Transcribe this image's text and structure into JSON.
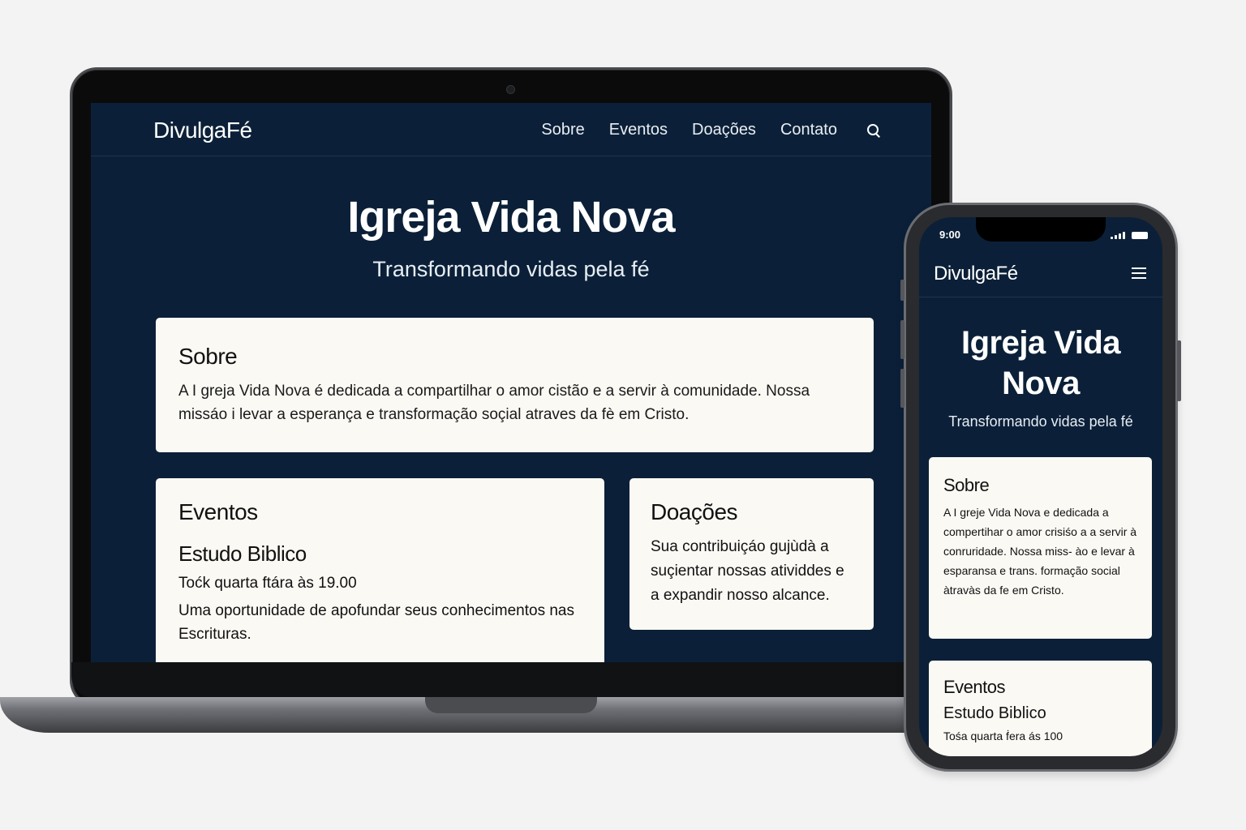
{
  "laptop": {
    "nav": {
      "logo": "DivulgaFé",
      "items": [
        {
          "label": "Sobre"
        },
        {
          "label": "Eventos"
        },
        {
          "label": "Doações"
        },
        {
          "label": "Contato"
        }
      ],
      "search_icon": "search-icon"
    },
    "hero": {
      "title": "Igreja Vida Nova",
      "subtitle": "Transformando vidas pela fé"
    },
    "sobre": {
      "heading": "Sobre",
      "text": "A I greja Vida Nova é dedicada a compartilhar o amor cistão e a servir à comunidade. Nossa missáo i levar a esperança e transformação soçial atraves da fè em Cristo."
    },
    "eventos": {
      "heading": "Eventos",
      "event_title": "Estudo Biblico",
      "when": "Toćk quarta ftára às 19.00",
      "description": "Uma oportunidade de apofundar seus conhecimentos nas Escrituras."
    },
    "doacoes": {
      "heading": "Doações",
      "text": "Sua contribuiçáo gujùdà a suçientar nossas atividdes e a expandir nosso alcance."
    }
  },
  "phone": {
    "status": {
      "time": "9:00"
    },
    "nav": {
      "logo": "DivulgaFé",
      "menu_icon": "hamburger-menu-icon"
    },
    "hero": {
      "title": "Igreja Vida Nova",
      "subtitle": "Transformando vidas pela fé"
    },
    "sobre": {
      "heading": "Sobre",
      "text": "A I greje Vida Nova e dedicada a compertihar o amor crisiśo a a servir à conruridade.  Nossa miss- ào e levar à esparansa e trans. formação social àtravàs da fe em Cristo."
    },
    "eventos": {
      "heading": "Eventos",
      "event_title": "Estudo Biblico",
      "when": "Tośa quarta ḟera ás 100"
    }
  },
  "colors": {
    "site_background": "#0b2038",
    "card_background": "#fbf9f4",
    "page_background": "#f3f3f3"
  }
}
